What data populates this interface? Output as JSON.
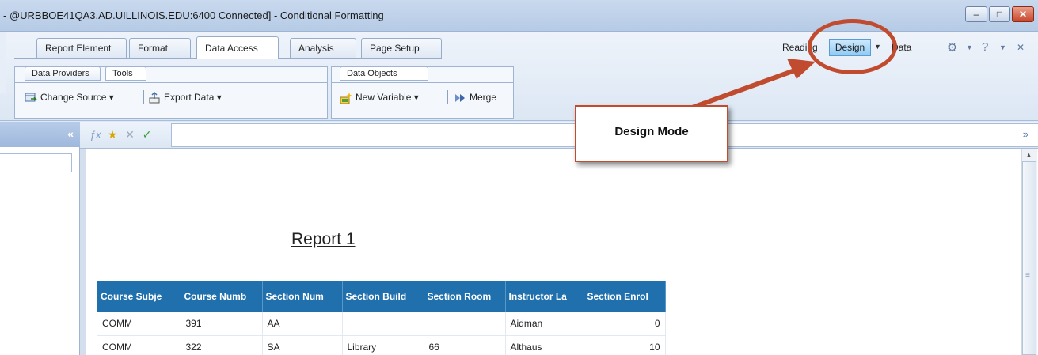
{
  "window": {
    "title": "- @URBBOE41QA3.AD.UILLINOIS.EDU:6400 Connected] - Conditional Formatting",
    "minimize": "–",
    "maximize": "□",
    "close": "✕"
  },
  "ribbon": {
    "tabs": [
      {
        "label": "Report Element",
        "active": false
      },
      {
        "label": "Format",
        "active": false
      },
      {
        "label": "Data Access",
        "active": true
      },
      {
        "label": "Analysis",
        "active": false
      },
      {
        "label": "Page Setup",
        "active": false
      }
    ],
    "modes": {
      "reading": "Reading",
      "design": "Design",
      "data": "Data",
      "dropdown": "▼"
    },
    "groups": {
      "providers": {
        "subtabs": [
          "Data Providers",
          "Tools"
        ],
        "change_source": "Change Source ▾",
        "export_data": "Export Data ▾"
      },
      "objects": {
        "subtab": "Data Objects",
        "new_variable": "New Variable ▾",
        "merge": "Merge"
      }
    }
  },
  "left_panel": {
    "collapse": "«"
  },
  "formula_bar": {
    "expand": "»"
  },
  "report": {
    "title": "Report 1",
    "columns": [
      "Course Subje",
      "Course Numb",
      "Section Num",
      "Section Build",
      "Section Room",
      "Instructor La",
      "Section Enrol"
    ],
    "rows": [
      [
        "COMM",
        "391",
        "AA",
        "",
        "",
        "Aidman",
        "0"
      ],
      [
        "COMM",
        "322",
        "SA",
        "Library",
        "66",
        "Althaus",
        "10"
      ]
    ]
  },
  "annotation": {
    "label": "Design Mode",
    "color": "#c14b2f"
  },
  "colors": {
    "table_header": "#1f70ad",
    "design_active": "#8fcbf2"
  }
}
